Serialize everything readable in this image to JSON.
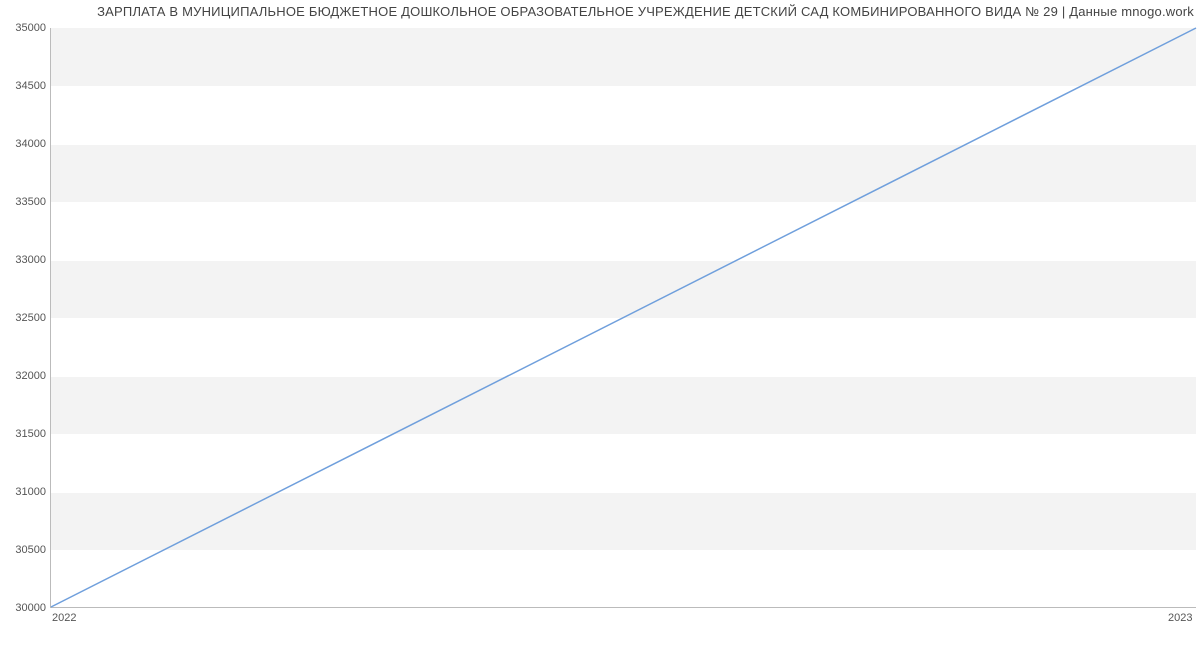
{
  "chart_data": {
    "type": "line",
    "title": "ЗАРПЛАТА В МУНИЦИПАЛЬНОЕ БЮДЖЕТНОЕ ДОШКОЛЬНОЕ ОБРАЗОВАТЕЛЬНОЕ УЧРЕЖДЕНИЕ ДЕТСКИЙ САД КОМБИНИРОВАННОГО ВИДА № 29 | Данные mnogo.work",
    "x": [
      2022,
      2023
    ],
    "values": [
      30000,
      35000
    ],
    "xticks": [
      "2022",
      "2023"
    ],
    "yticks": [
      30000,
      30500,
      31000,
      31500,
      32000,
      32500,
      33000,
      33500,
      34000,
      34500,
      35000
    ],
    "xlim": [
      2022,
      2023
    ],
    "ylim": [
      30000,
      35000
    ],
    "line_color": "#6f9fdc"
  }
}
